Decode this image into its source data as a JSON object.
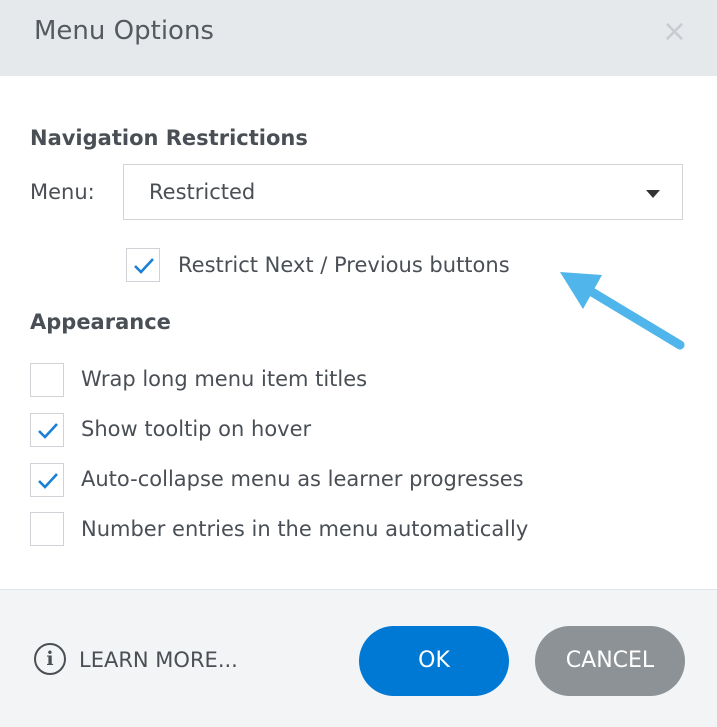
{
  "dialog": {
    "title": "Menu Options",
    "close_glyph": "×"
  },
  "navigation": {
    "heading": "Navigation Restrictions",
    "menu_label": "Menu:",
    "menu_value": "Restricted",
    "restrict_next_prev": {
      "label": "Restrict Next / Previous buttons",
      "checked": true
    }
  },
  "appearance": {
    "heading": "Appearance",
    "options": [
      {
        "label": "Wrap long menu item titles",
        "checked": false
      },
      {
        "label": "Show tooltip on hover",
        "checked": true
      },
      {
        "label": "Auto-collapse menu as learner progresses",
        "checked": true
      },
      {
        "label": "Number entries in the menu automatically",
        "checked": false
      }
    ]
  },
  "footer": {
    "info_glyph": "i",
    "learn_more": "LEARN MORE...",
    "ok": "OK",
    "cancel": "CANCEL"
  },
  "colors": {
    "accent": "#0079d4",
    "check": "#1a7fd6",
    "arrow": "#4fb5ea",
    "cancel": "#8d9296"
  },
  "icons": [
    "close-icon",
    "chevron-down-icon",
    "checkmark-icon",
    "info-icon",
    "arrow-icon"
  ]
}
